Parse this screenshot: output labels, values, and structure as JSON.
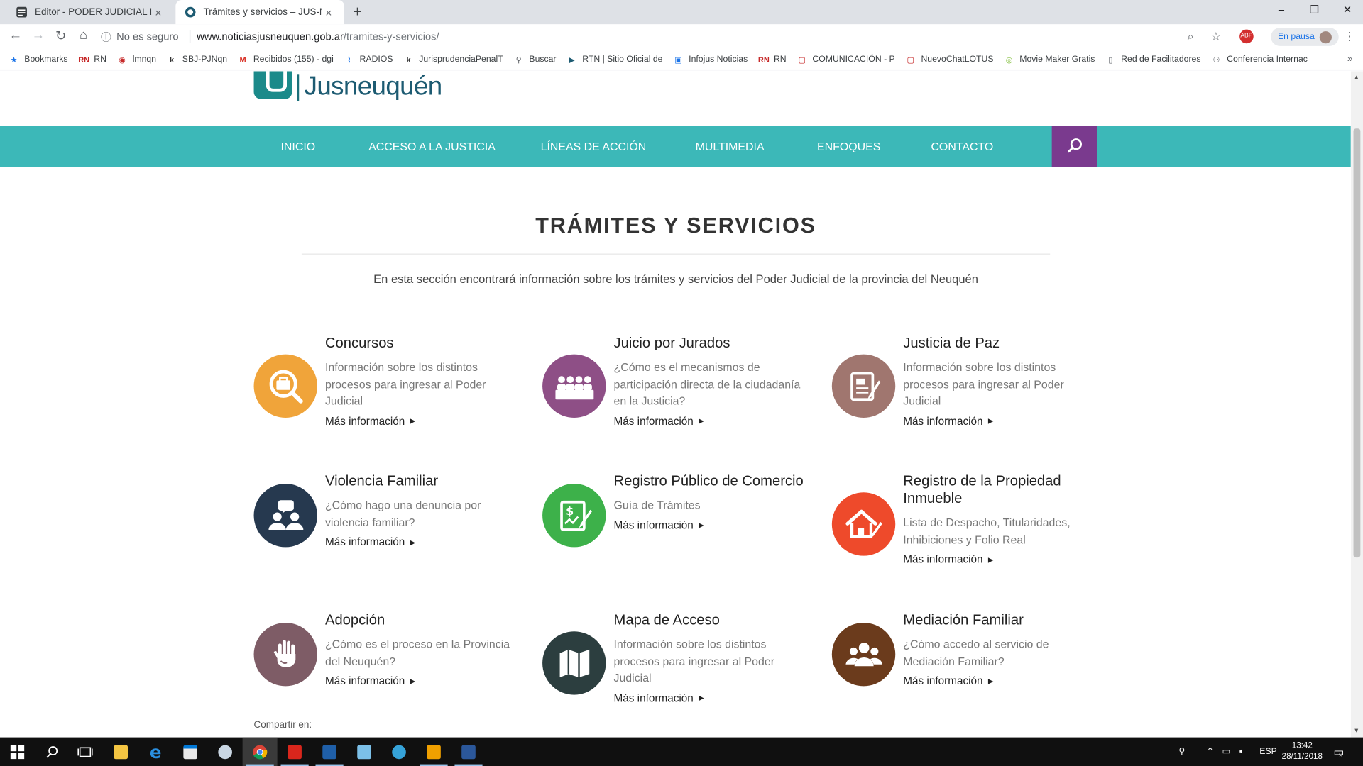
{
  "browser": {
    "tabs": [
      {
        "title": "Editor - PODER JUDICIAL DE NEU",
        "close": "×"
      },
      {
        "title": "Trámites y servicios – JUS-NQN",
        "close": "×"
      }
    ],
    "new_tab": "+",
    "window_controls": {
      "minimize": "–",
      "maximize": "❐",
      "close": "✕"
    },
    "omnibox": {
      "security": "No es seguro",
      "host": "www.noticiasjusneuquen.gob.ar",
      "path": "/tramites-y-servicios/"
    },
    "profile_status": "En pausa",
    "bookmarks": [
      {
        "label": "Bookmarks",
        "icon": "star-icon",
        "color": "#1a73e8"
      },
      {
        "label": "RN",
        "icon": "rn-logo",
        "color": "#c62828"
      },
      {
        "label": "lmnqn",
        "icon": "lmn-logo",
        "color": "#c62828"
      },
      {
        "label": "SBJ-PJNqn",
        "icon": "k-logo",
        "color": "#333333"
      },
      {
        "label": "Recibidos (155) - dgi",
        "icon": "gmail-icon",
        "color": "#d93025"
      },
      {
        "label": "RADIOS",
        "icon": "radio-icon",
        "color": "#1a73e8"
      },
      {
        "label": "JurisprudenciaPenalT",
        "icon": "k-logo",
        "color": "#333333"
      },
      {
        "label": "Buscar",
        "icon": "search-icon",
        "color": "#5f6368"
      },
      {
        "label": "RTN | Sitio Oficial de",
        "icon": "rtn-logo",
        "color": "#1d5b72"
      },
      {
        "label": "Infojus Noticias",
        "icon": "infojus-logo",
        "color": "#1a73e8"
      },
      {
        "label": "RN",
        "icon": "rn-logo",
        "color": "#c62828"
      },
      {
        "label": "COMUNICACIÓN - P",
        "icon": "chat-icon",
        "color": "#c62828"
      },
      {
        "label": "NuevoChatLOTUS",
        "icon": "chat-icon",
        "color": "#c62828"
      },
      {
        "label": "Movie Maker Gratis",
        "icon": "camera-icon",
        "color": "#8bc34a"
      },
      {
        "label": "Red de Facilitadores",
        "icon": "page-icon",
        "color": "#5f6368"
      },
      {
        "label": "Conferencia Internac",
        "icon": "people-icon",
        "color": "#5f6368"
      }
    ],
    "bookmarks_more": "»"
  },
  "site": {
    "logo_text": "Jusneuquén",
    "nav": [
      "INICIO",
      "ACCESO A LA JUSTICIA",
      "LÍNEAS DE ACCIÓN",
      "MULTIMEDIA",
      "ENFOQUES",
      "CONTACTO"
    ],
    "colors": {
      "nav": "#3cb8b8",
      "search": "#7a3a8e"
    }
  },
  "main": {
    "title": "TRÁMITES Y SERVICIOS",
    "intro": "En esta sección encontrará información sobre los trámites y servicios del Poder Judicial de la provincia del Neuquén",
    "more_label": "Más información",
    "cards": [
      {
        "title": "Concursos",
        "desc": "Información sobre los distintos procesos para ingresar al Poder Judicial",
        "icon": "magnifier-briefcase-icon",
        "color": "#f0a43a"
      },
      {
        "title": "Juicio por Jurados",
        "desc": "¿Cómo es el mecanismos de participación directa de la ciudadanía en la Justicia?",
        "icon": "jury-icon",
        "color": "#8e4f86"
      },
      {
        "title": "Justicia de Paz",
        "desc": "Información sobre los distintos procesos para ingresar al Poder Judicial",
        "icon": "document-pen-icon",
        "color": "#a0766f"
      },
      {
        "title": "Violencia Familiar",
        "desc": "¿Cómo hago una denuncia por violencia familiar?",
        "icon": "people-chat-icon",
        "color": "#26394f"
      },
      {
        "title": "Registro Público de Comercio",
        "desc": "Guía de Trámites",
        "icon": "money-document-icon",
        "color": "#3db14a"
      },
      {
        "title": "Registro de la Propiedad Inmueble",
        "desc": "Lista de Despacho, Titularidades, Inhibiciones y Folio Real",
        "icon": "house-pen-icon",
        "color": "#ee4a2b"
      },
      {
        "title": "Adopción",
        "desc": "¿Cómo es el proceso en la Provincia del Neuquén?",
        "icon": "hands-icon",
        "color": "#7e5c66"
      },
      {
        "title": "Mapa de Acceso",
        "desc": "Información sobre los distintos procesos para ingresar al Poder Judicial",
        "icon": "map-icon",
        "color": "#2c3e3f"
      },
      {
        "title": "Mediación Familiar",
        "desc": "¿Cómo accedo al servicio de Mediación Familiar?",
        "icon": "family-icon",
        "color": "#6b3b1c"
      }
    ],
    "share": "Compartir en:"
  },
  "taskbar": {
    "apps": [
      "start-icon",
      "search-icon",
      "task-view-icon",
      "file-explorer-icon",
      "edge-icon",
      "store-icon",
      "app-icon",
      "chrome-icon",
      "acrobat-icon",
      "app-icon",
      "app-icon",
      "app-icon",
      "outlook-icon",
      "word-icon"
    ],
    "language": "ESP",
    "time": "13:42",
    "date": "28/11/2018",
    "notifications": "9"
  }
}
